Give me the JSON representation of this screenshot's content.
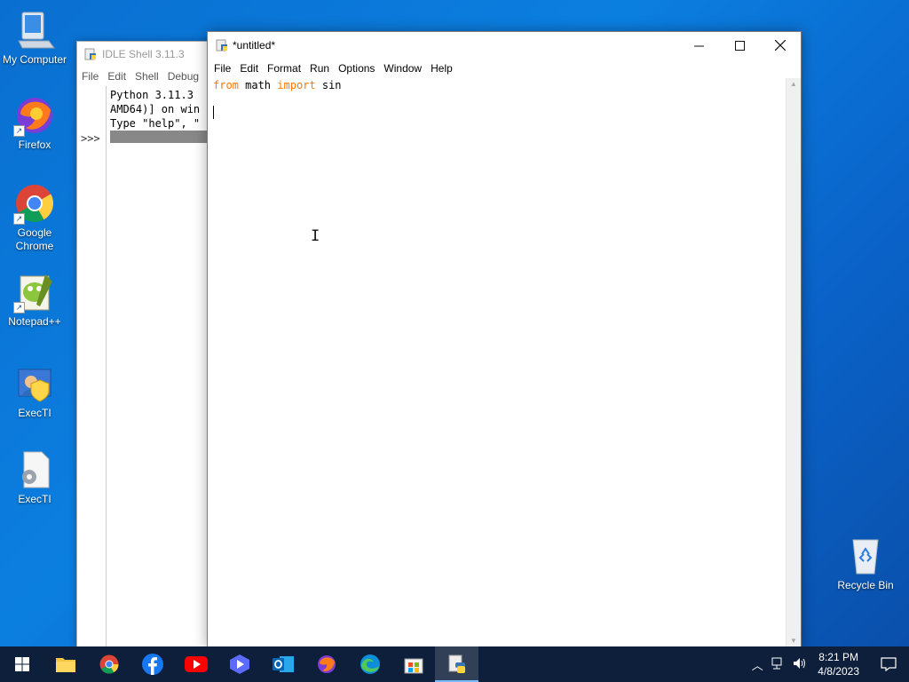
{
  "desktop": {
    "icons": [
      {
        "label": "My Computer"
      },
      {
        "label": "Firefox"
      },
      {
        "label": "Google Chrome"
      },
      {
        "label": "Notepad++"
      },
      {
        "label": "ExecTI"
      },
      {
        "label": "ExecTI"
      },
      {
        "label": "Recycle Bin"
      }
    ]
  },
  "shell": {
    "title": "IDLE Shell 3.11.3",
    "menu": [
      "File",
      "Edit",
      "Shell",
      "Debug"
    ],
    "lines": [
      "Python 3.11.3",
      "AMD64)] on win",
      "Type \"help\", \""
    ],
    "prompt": ">>>"
  },
  "editor": {
    "title": "*untitled*",
    "menu": [
      "File",
      "Edit",
      "Format",
      "Run",
      "Options",
      "Window",
      "Help"
    ],
    "code": {
      "kw1": "from",
      "mod": " math ",
      "kw2": "import",
      "name": " sin"
    },
    "keyword_color": "#ff7700"
  },
  "taskbar": {
    "apps": [
      "start-icon",
      "file-explorer-icon",
      "chrome-icon",
      "facebook-icon",
      "youtube-icon",
      "video-editor-icon",
      "outlook-icon",
      "firefox-icon",
      "edge-icon",
      "store-icon",
      "python-idle-icon"
    ],
    "time": "8:21 PM",
    "date": "4/8/2023"
  }
}
